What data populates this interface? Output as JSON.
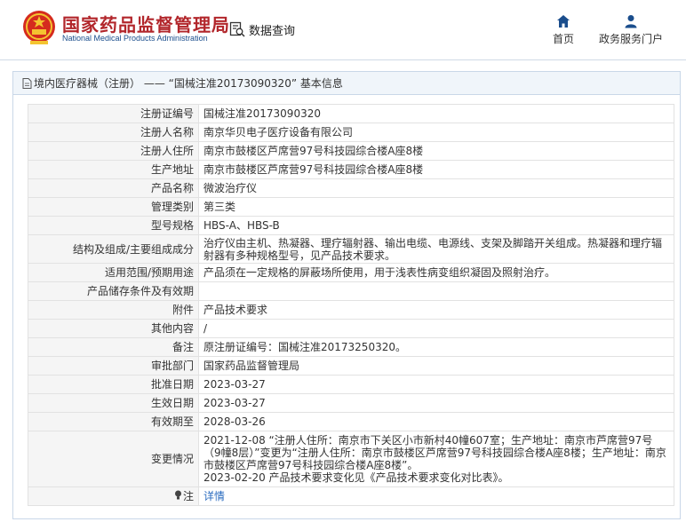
{
  "header": {
    "title": "国家药品监督管理局",
    "subtitle": "National Medical Products Administration",
    "query_label": "数据查询",
    "nav": [
      {
        "label": "首页",
        "icon": "home-icon"
      },
      {
        "label": "政务服务门户",
        "icon": "user-icon"
      }
    ]
  },
  "breadcrumb": "境内医疗器械（注册） —— “国械注准20173090320” 基本信息",
  "record": {
    "fields": [
      {
        "label": "注册证编号",
        "value": "国械注准20173090320"
      },
      {
        "label": "注册人名称",
        "value": "南京华贝电子医疗设备有限公司"
      },
      {
        "label": "注册人住所",
        "value": "南京市鼓楼区芦席营97号科技园综合楼A座8楼"
      },
      {
        "label": "生产地址",
        "value": "南京市鼓楼区芦席营97号科技园综合楼A座8楼"
      },
      {
        "label": "产品名称",
        "value": "微波治疗仪"
      },
      {
        "label": "管理类别",
        "value": "第三类"
      },
      {
        "label": "型号规格",
        "value": "HBS-A、HBS-B"
      },
      {
        "label": "结构及组成/主要组成成分",
        "value": "治疗仪由主机、热凝器、理疗辐射器、输出电缆、电源线、支架及脚踏开关组成。热凝器和理疗辐射器有多种规格型号，见产品技术要求。"
      },
      {
        "label": "适用范围/预期用途",
        "value": "产品须在一定规格的屏蔽场所使用，用于浅表性病变组织凝固及照射治疗。"
      },
      {
        "label": "产品储存条件及有效期",
        "value": ""
      },
      {
        "label": "附件",
        "value": "产品技术要求"
      },
      {
        "label": "其他内容",
        "value": "/"
      },
      {
        "label": "备注",
        "value": "原注册证编号：国械注准20173250320。"
      },
      {
        "label": "审批部门",
        "value": "国家药品监督管理局"
      },
      {
        "label": "批准日期",
        "value": "2023-03-27"
      },
      {
        "label": "生效日期",
        "value": "2023-03-27"
      },
      {
        "label": "有效期至",
        "value": "2028-03-26"
      }
    ],
    "change": {
      "label": "变更情况",
      "entries": [
        "2021-12-08 “注册人住所：南京市下关区小市新村40幢607室；生产地址：南京市芦席营97号（9幢8层）”变更为“注册人住所：南京市鼓楼区芦席营97号科技园综合楼A座8楼；生产地址：南京市鼓楼区芦席营97号科技园综合楼A座8楼”。",
        "2023-02-20 产品技术要求变化见《产品技术要求变化对比表》。"
      ]
    },
    "note": {
      "label": "注",
      "link": "详情"
    }
  },
  "colors": {
    "brand_red": "#b2262b",
    "brand_blue": "#1a4d8c",
    "link": "#2a6bbf",
    "label_bg": "#f5f5f5"
  }
}
